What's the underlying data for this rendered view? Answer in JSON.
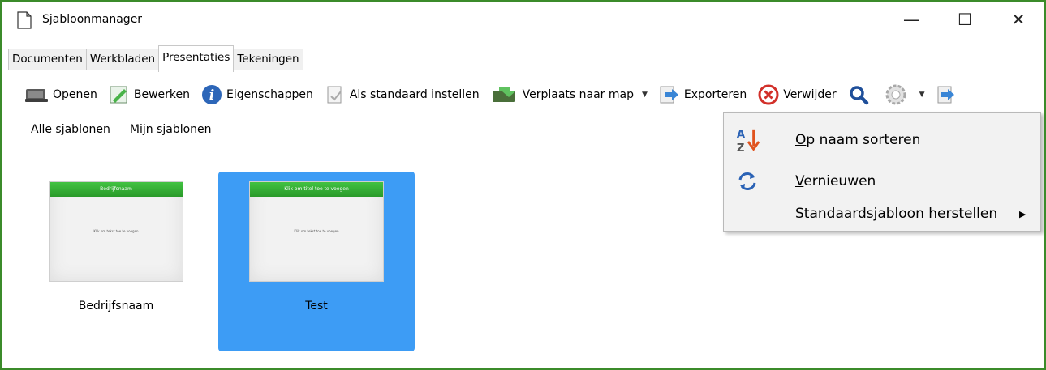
{
  "window": {
    "title": "Sjabloonmanager",
    "minimize": "—",
    "maximize": "☐",
    "close": "✕"
  },
  "tabs": [
    {
      "label": "Documenten"
    },
    {
      "label": "Werkbladen"
    },
    {
      "label": "Presentaties"
    },
    {
      "label": "Tekeningen"
    }
  ],
  "toolbar": {
    "open": "Openen",
    "edit": "Bewerken",
    "properties": "Eigenschappen",
    "set_default": "Als standaard instellen",
    "move": "Verplaats naar map",
    "export": "Exporteren",
    "delete": "Verwijder"
  },
  "filters": {
    "all": "Alle sjablonen",
    "mine": "Mijn sjablonen"
  },
  "templates": [
    {
      "name": "Bedrijfsnaam",
      "thumb_title": "Bedrijfsnaam",
      "thumb_body": "Klik om tekst toe te voegen"
    },
    {
      "name": "Test",
      "thumb_title": "Klik om titel toe te voegen",
      "thumb_body": "Klik om tekst toe te voegen"
    }
  ],
  "menu": {
    "sort_first": "O",
    "sort_rest": "p naam sorteren",
    "refresh_first": "V",
    "refresh_rest": "ernieuwen",
    "reset_first": "S",
    "reset_rest": "tandaardsjabloon herstellen",
    "submenu_arrow": "▶"
  },
  "colors": {
    "window_border": "#3b8b2a",
    "selection": "#3d9cf5",
    "thumb_header": "#2a9a2a"
  }
}
